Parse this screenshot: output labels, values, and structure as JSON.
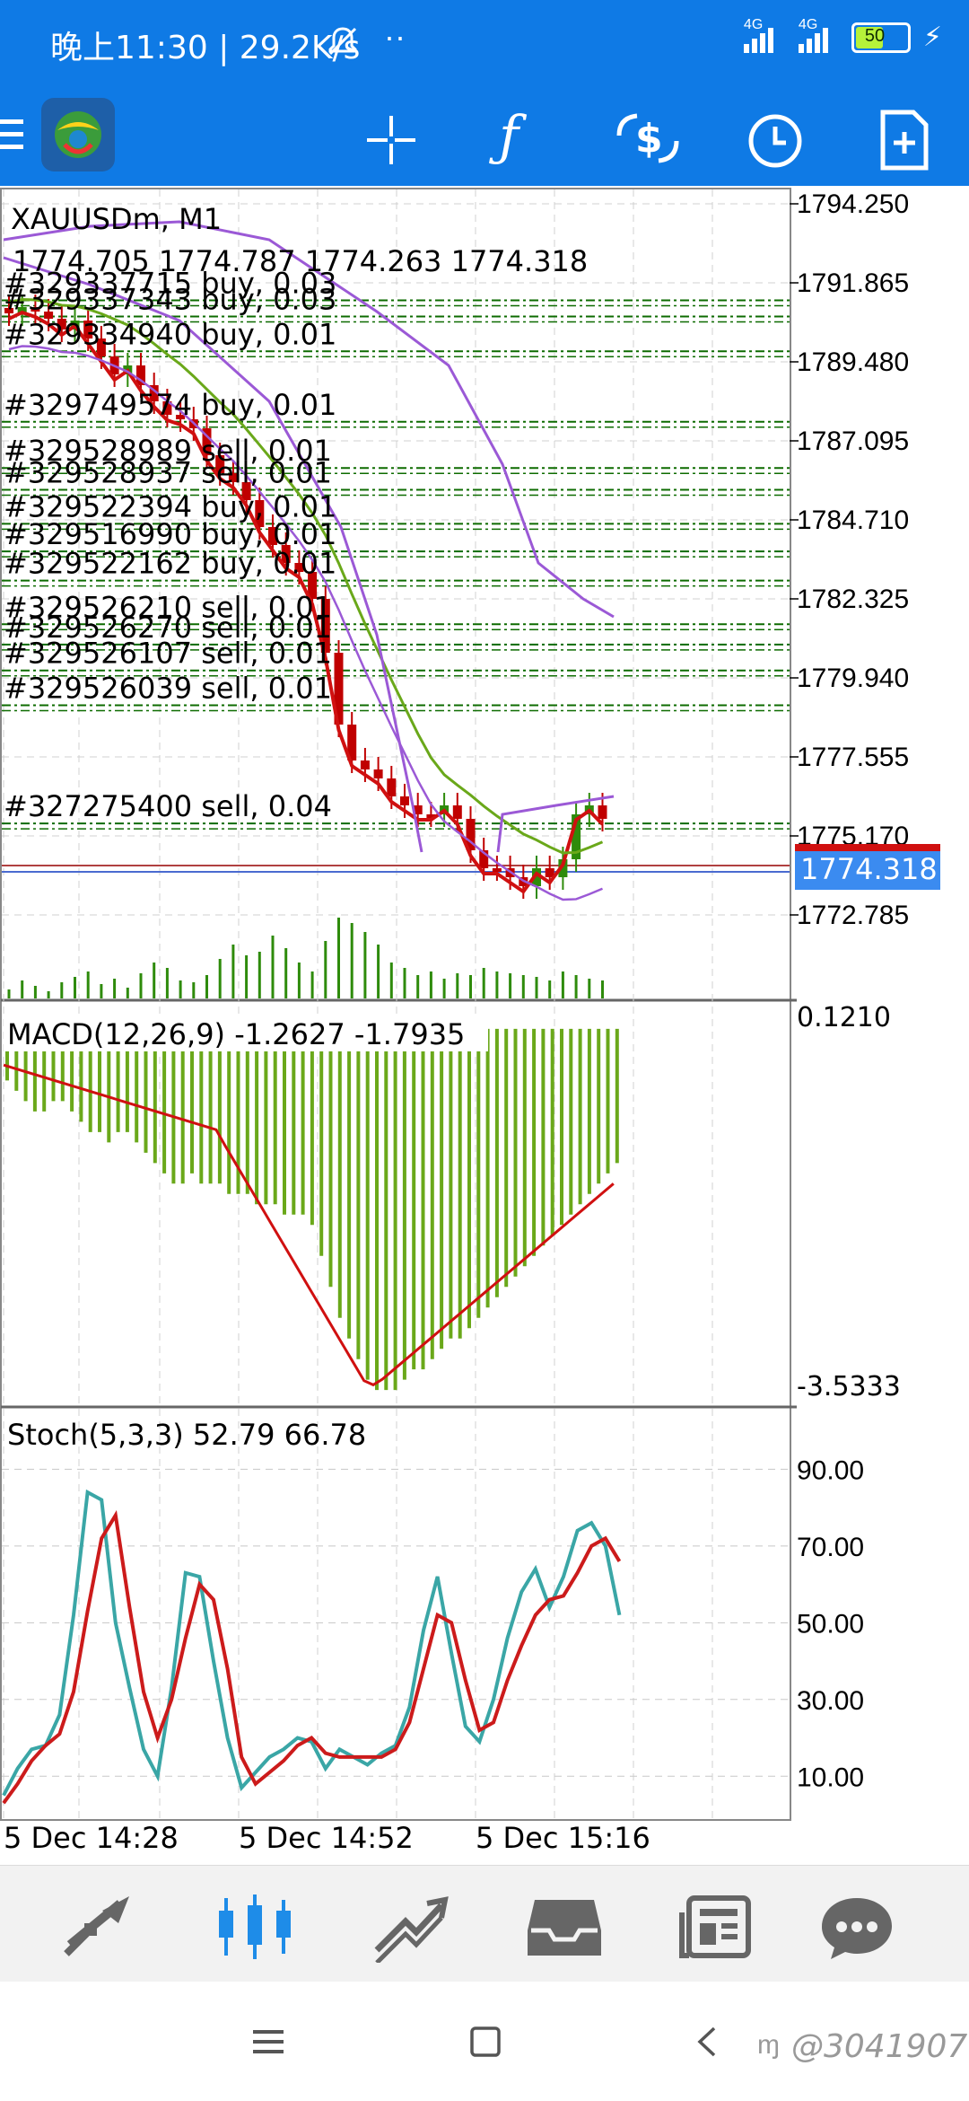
{
  "status_bar": {
    "time": "晚上11:30 | 29.2K/s",
    "battery": "50",
    "net1": "4G",
    "net2": "4G"
  },
  "toolbar": {
    "icons": [
      "menu-icon",
      "app-logo",
      "crosshair-icon",
      "function-icon",
      "trade-icon",
      "clock-icon",
      "new-document-icon"
    ]
  },
  "main_chart": {
    "symbol": "XAUUSDm, M1",
    "ohlc": "1774.705 1774.787 1774.263 1774.318",
    "current_price": "1774.318",
    "price_labels": [
      "1794.250",
      "1791.865",
      "1789.480",
      "1787.095",
      "1784.710",
      "1782.325",
      "1779.940",
      "1777.555",
      "1775.170",
      "1772.785"
    ],
    "orders": [
      {
        "label": "#329337715 buy, 0.03",
        "ty": 0.138
      },
      {
        "label": "#329337343 buy, 0.03",
        "ty": 0.158
      },
      {
        "label": "#329334940 buy, 0.01",
        "ty": 0.201
      },
      {
        "label": "#329749574 buy, 0.01",
        "ty": 0.288
      },
      {
        "label": "#329528989 sell, 0.01",
        "ty": 0.345
      },
      {
        "label": "#329528937 sell, 0.01",
        "ty": 0.372
      },
      {
        "label": "#329522394 buy, 0.01",
        "ty": 0.414
      },
      {
        "label": "#329516990 buy, 0.01",
        "ty": 0.448
      },
      {
        "label": "#329522162 buy, 0.01",
        "ty": 0.484
      },
      {
        "label": "#329526210 sell, 0.01",
        "ty": 0.538
      },
      {
        "label": "#329526270 sell, 0.01",
        "ty": 0.563
      },
      {
        "label": "#329526107 sell, 0.01",
        "ty": 0.595
      },
      {
        "label": "#329526039 sell, 0.01",
        "ty": 0.638
      },
      {
        "label": "#327275400 sell, 0.04",
        "ty": 0.784
      }
    ]
  },
  "macd": {
    "label": "MACD(12,26,9) -1.2627 -1.7935",
    "top_value": "0.1210",
    "bottom_value": "-3.5333",
    "histogram": [
      -0.5,
      -0.6,
      -0.7,
      -0.8,
      -0.8,
      -0.7,
      -0.7,
      -0.8,
      -0.9,
      -1.0,
      -1.0,
      -1.1,
      -1.0,
      -1.0,
      -1.1,
      -1.2,
      -1.3,
      -1.4,
      -1.5,
      -1.5,
      -1.4,
      -1.5,
      -1.5,
      -1.5,
      -1.6,
      -1.6,
      -1.6,
      -1.7,
      -1.7,
      -1.7,
      -1.8,
      -1.8,
      -1.8,
      -1.9,
      -2.2,
      -2.5,
      -2.8,
      -3.0,
      -3.2,
      -3.4,
      -3.5,
      -3.5,
      -3.5,
      -3.4,
      -3.3,
      -3.3,
      -3.2,
      -3.1,
      -3.0,
      -3.0,
      -2.9,
      -2.8,
      -2.7,
      -2.6,
      -2.5,
      -2.4,
      -2.3,
      -2.2,
      -2.1,
      -2.0,
      -1.9,
      -1.8,
      -1.7,
      -1.6,
      -1.5,
      -1.4,
      -1.3
    ]
  },
  "stoch": {
    "label": "Stoch(5,3,3) 52.79 66.78",
    "levels": [
      "90.00",
      "70.00",
      "50.00",
      "30.00",
      "10.00"
    ],
    "main": [
      5,
      12,
      17,
      18,
      26,
      52,
      84,
      82,
      50,
      33,
      17,
      10,
      33,
      63,
      62,
      40,
      20,
      7,
      11,
      15,
      17,
      20,
      19,
      12,
      17,
      15,
      13,
      16,
      18,
      28,
      48,
      62,
      42,
      23,
      19,
      30,
      46,
      58,
      64,
      54,
      62,
      74,
      76,
      70,
      52
    ],
    "signal": [
      3,
      8,
      14,
      18,
      21,
      32,
      53,
      72,
      78,
      54,
      32,
      20,
      30,
      46,
      60,
      56,
      38,
      15,
      8,
      11,
      14,
      18,
      20,
      16,
      15,
      15,
      15,
      15,
      17,
      24,
      38,
      52,
      50,
      35,
      22,
      24,
      35,
      44,
      52,
      56,
      57,
      63,
      70,
      72,
      66
    ]
  },
  "time_labels": [
    "5 Dec 14:28",
    "5 Dec 14:52",
    "5 Dec 15:16"
  ],
  "tab_bar": {
    "tabs": [
      "quotes-tab",
      "chart-tab",
      "trade-tab",
      "history-tab",
      "news-tab",
      "chat-tab"
    ]
  },
  "nav_bar": {
    "watermark": "@3041907"
  },
  "colors": {
    "accent": "#0f7ae5",
    "bull": "#2e8b0b",
    "bear": "#c00000",
    "bollinger": "#9b59d6",
    "ma_red": "#d01010",
    "ma_green": "#6aa81a",
    "macd_hist": "#6aa81a",
    "stoch_main": "#3aa6a6",
    "stoch_signal": "#cc1b1b",
    "price_tag": "#3b8bf0"
  }
}
